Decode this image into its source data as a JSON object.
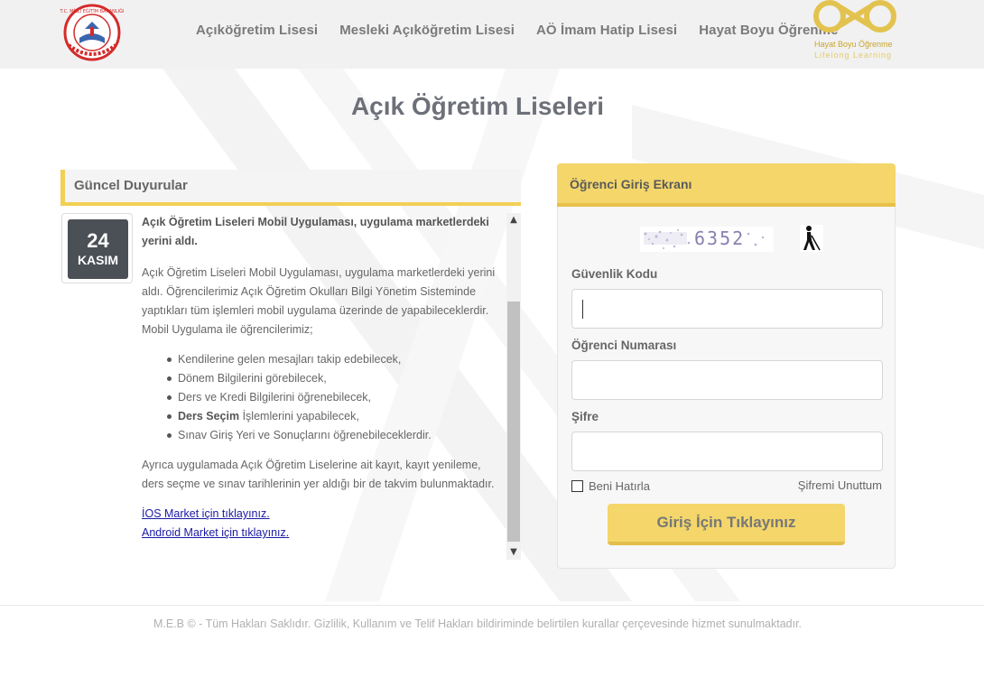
{
  "header": {
    "nav": [
      {
        "label": "Açıköğretim Lisesi"
      },
      {
        "label": "Mesleki Açıköğretim Lisesi"
      },
      {
        "label": "AÖ İmam Hatip Lisesi"
      },
      {
        "label": "Hayat Boyu Öğrenme"
      }
    ],
    "right_logo": {
      "line1": "Hayat Boyu Öğrenme",
      "line2": "Lifelong Learning",
      "icon": "infinity-logo"
    },
    "left_logo": {
      "text": "T.C. MİLLİ EĞİTİM BAKANLIĞI",
      "icon": "meb-seal"
    }
  },
  "page_title": "Açık Öğretim Liseleri",
  "announcements": {
    "heading": "Güncel Duyurular",
    "date": {
      "day": "24",
      "month": "KASIM"
    },
    "title": "Açık Öğretim Liseleri Mobil Uygulaması, uygulama marketlerdeki yerini aldı.",
    "paragraph1": "Açık Öğretim Liseleri Mobil Uygulaması, uygulama marketlerdeki yerini aldı. Öğrencilerimiz Açık Öğretim Okulları Bilgi Yönetim Sisteminde yaptıkları tüm işlemleri mobil uygulama üzerinde de yapabileceklerdir. Mobil Uygulama ile öğrencilerimiz;",
    "list": [
      {
        "bold": "",
        "text": "Kendilerine gelen mesajları takip edebilecek,"
      },
      {
        "bold": "",
        "text": "Dönem Bilgilerini görebilecek,"
      },
      {
        "bold": "",
        "text": "Ders ve Kredi Bilgilerini öğrenebilecek,"
      },
      {
        "bold": "Ders Seçim",
        "text": " İşlemlerini yapabilecek,"
      },
      {
        "bold": "",
        "text": "Sınav Giriş Yeri ve Sonuçlarını öğrenebileceklerdir."
      }
    ],
    "paragraph2": "Ayrıca uygulamada Açık Öğretim Liselerine ait kayıt, kayıt yenileme, ders seçme ve sınav tarihlerinin yer aldığı bir de takvim bulunmaktadır.",
    "links": [
      "İOS Market için tıklayınız.",
      "Android Market için tıklayınız."
    ]
  },
  "login": {
    "heading": "Öğrenci Giriş Ekranı",
    "captcha": "6352",
    "security_label": "Güvenlik Kodu",
    "student_no_label": "Öğrenci Numarası",
    "password_label": "Şifre",
    "remember_label": "Beni Hatırla",
    "forgot_label": "Şifremi Unuttum",
    "submit_label": "Giriş İçin Tıklayınız"
  },
  "footer": "M.E.B © - Tüm Hakları Saklıdır. Gizlilik, Kullanım ve Telif Hakları bildiriminde belirtilen kurallar çerçevesinde hizmet sunulmaktadır.",
  "colors": {
    "accent": "#f4d66a",
    "accent_dark": "#e8c04a",
    "header_bg": "#f1f1f1"
  }
}
